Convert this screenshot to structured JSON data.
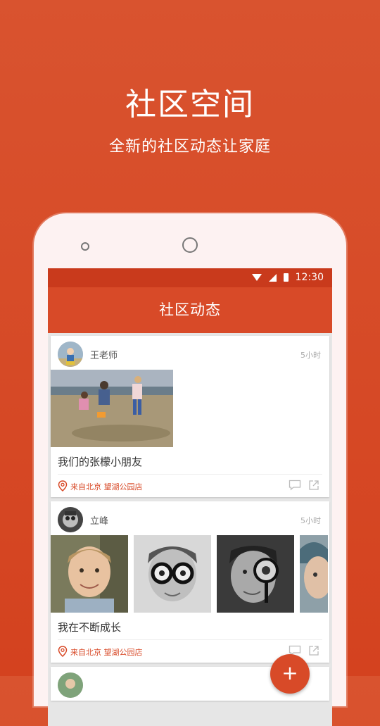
{
  "hero": {
    "title": "社区空间",
    "subtitle": "全新的社区动态让家庭"
  },
  "status_bar": {
    "time": "12:30"
  },
  "app_bar": {
    "title": "社区动态"
  },
  "feed": [
    {
      "author": "王老师",
      "time": "5小时",
      "text": "我们的张檬小朋友",
      "location": "来自北京  望湖公园店"
    },
    {
      "author": "立峰",
      "time": "5小时",
      "text": "我在不断成长",
      "location": "来自北京  望湖公园店"
    }
  ],
  "fab": {
    "label": "+"
  },
  "colors": {
    "brand": "#d84a28",
    "background": "#d4421f"
  },
  "icons": {
    "location": "location-pin-icon",
    "comment": "comment-icon",
    "share": "share-icon",
    "add": "add-icon"
  }
}
